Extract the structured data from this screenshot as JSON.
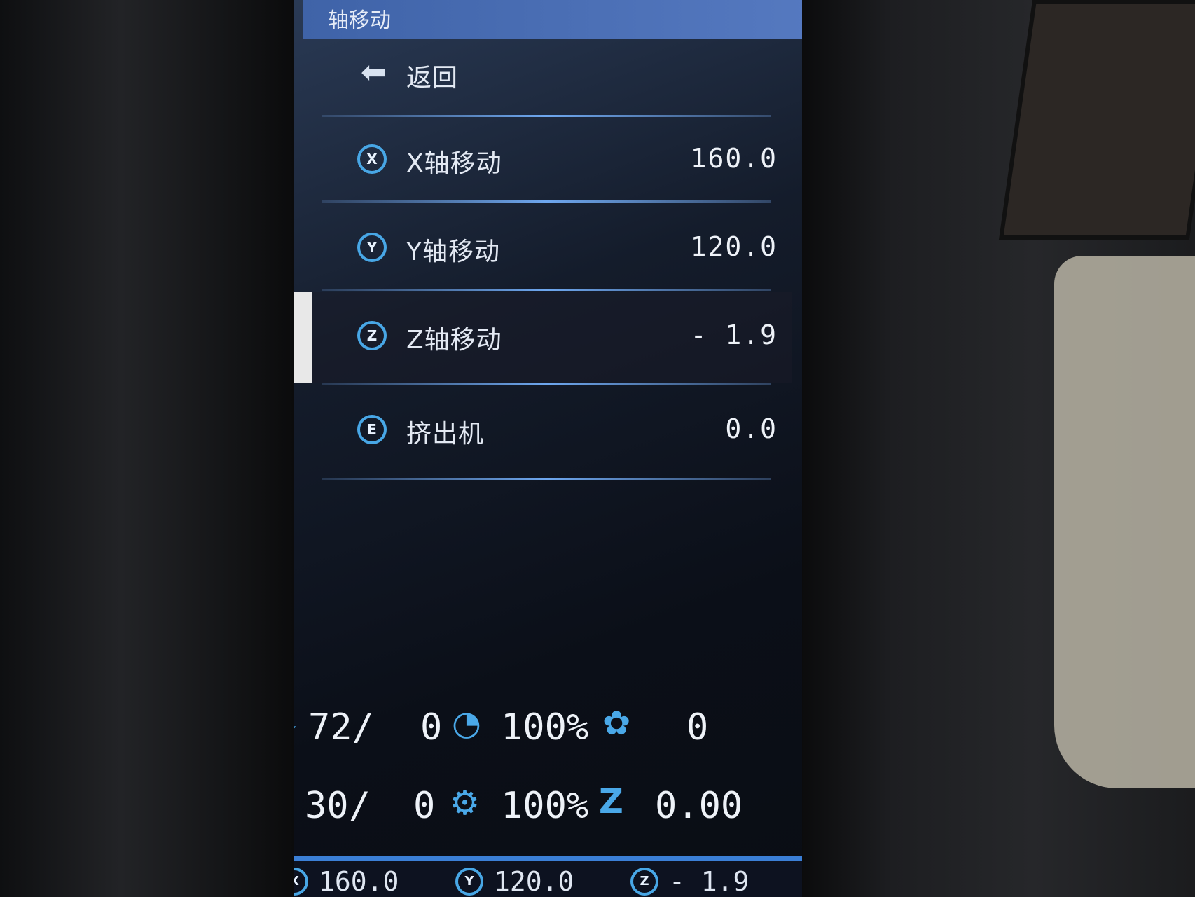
{
  "screen": {
    "title": "轴移动",
    "menu": [
      {
        "label": "返回",
        "value": "",
        "icon": "back-arrow-icon"
      },
      {
        "label": "X轴移动",
        "value": "160.0",
        "icon": "x-axis-icon",
        "icon_glyph": "X"
      },
      {
        "label": "Y轴移动",
        "value": "120.0",
        "icon": "y-axis-icon",
        "icon_glyph": "Y"
      },
      {
        "label": "Z轴移动",
        "value": "- 1.9",
        "icon": "z-axis-icon",
        "icon_glyph": "Z",
        "selected": true
      },
      {
        "label": "挤出机",
        "value": "0.0",
        "icon": "extruder-icon",
        "icon_glyph": "E"
      }
    ],
    "status": {
      "hotend_temp": "72/",
      "hotend_target": "0",
      "speed": "100%",
      "fan": "0",
      "bed_temp": "30/",
      "bed_target": "0",
      "flow": "100%",
      "z_offset": "0.00"
    },
    "bottom": {
      "x": "160.0",
      "y": "120.0",
      "z": "- 1.9"
    }
  },
  "colors": {
    "accent": "#48a7e6",
    "title_bar": "#4a6fb5",
    "divider": "#6ea7ef"
  }
}
